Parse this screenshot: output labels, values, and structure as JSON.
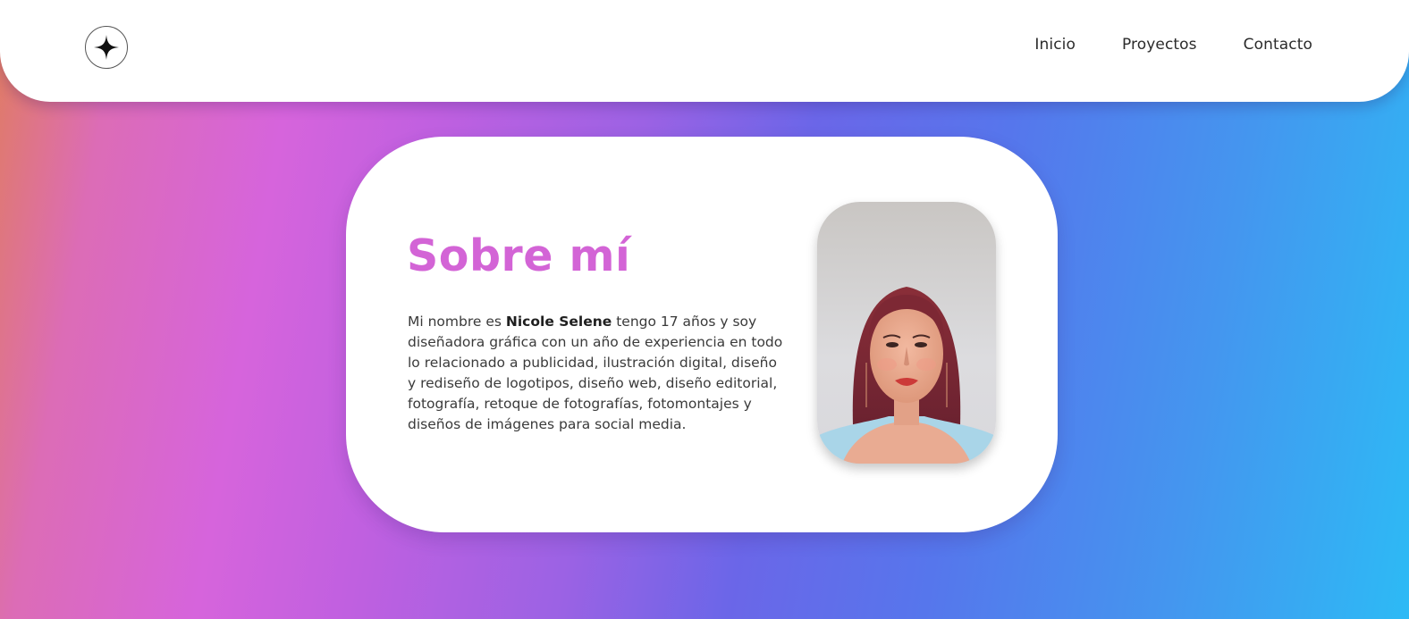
{
  "header": {
    "logo_icon": "four-point-star-icon",
    "nav": [
      {
        "label": "Inicio"
      },
      {
        "label": "Proyectos"
      },
      {
        "label": "Contacto"
      }
    ]
  },
  "about": {
    "title": "Sobre mí",
    "text_before_name": "Mi nombre es ",
    "name": "Nicole Selene",
    "text_after_name": " tengo 17 años y soy diseñadora gráfica con un año de experiencia en todo lo relacionado a publicidad, ilustración digital, diseño y rediseño de logotipos, diseño web, diseño editorial, fotografía, retoque de fotografías, fotomontajes y diseños de imágenes para social media.",
    "photo": "profile-portrait-photo"
  },
  "colors": {
    "accent": "#d364d6",
    "gradient_start": "#e07c62",
    "gradient_mid": "#6b66e8",
    "gradient_end": "#2dbaf5"
  }
}
